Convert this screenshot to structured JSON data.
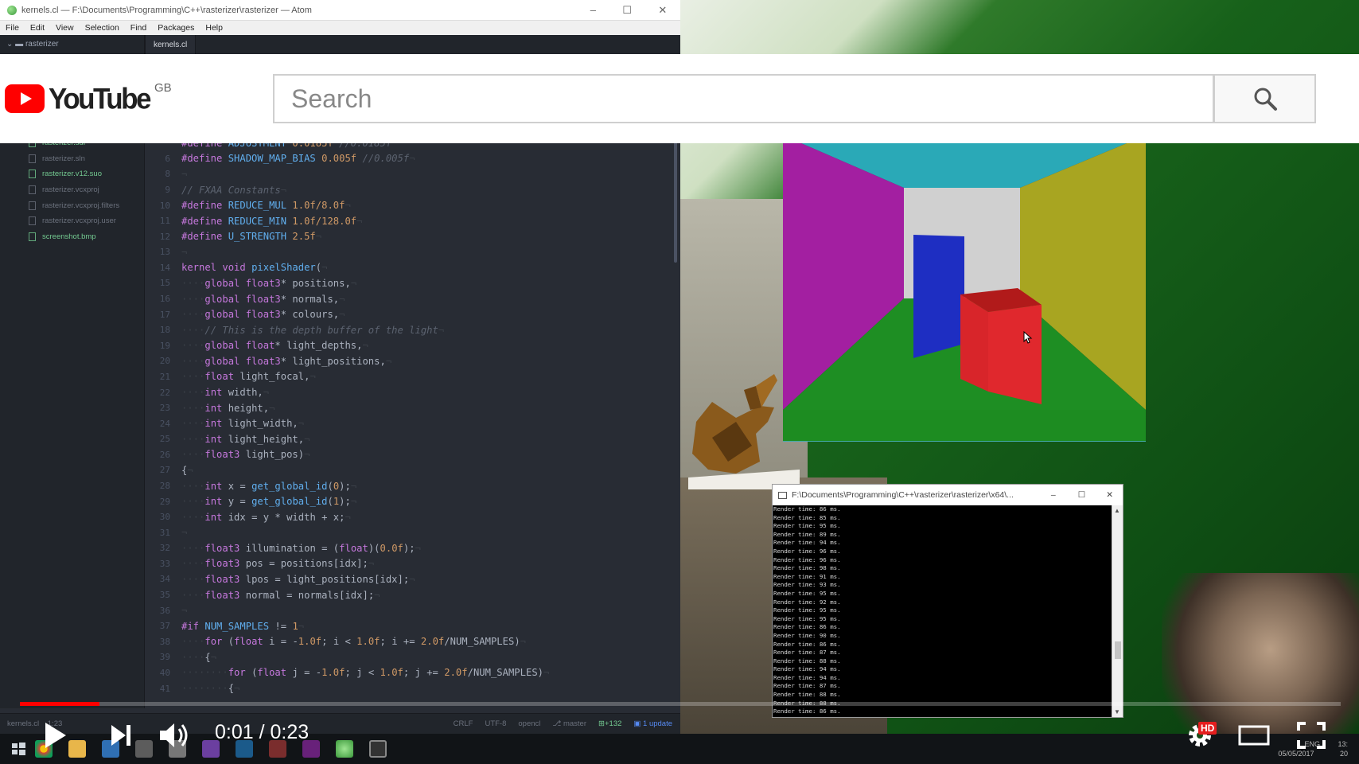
{
  "atom": {
    "title": "kernels.cl — F:\\Documents\\Programming\\C++\\rasterizer\\rasterizer — Atom",
    "menu": [
      "File",
      "Edit",
      "View",
      "Selection",
      "Find",
      "Packages",
      "Help"
    ],
    "tree_root": "rasterizer",
    "active_tab": "kernels.cl",
    "files": [
      {
        "name": "rasterizer.sdf",
        "color": "#73c990"
      },
      {
        "name": "rasterizer.sln",
        "color": "#6b717d"
      },
      {
        "name": "rasterizer.v12.suo",
        "color": "#73c990"
      },
      {
        "name": "rasterizer.vcxproj",
        "color": "#6b717d"
      },
      {
        "name": "rasterizer.vcxproj.filters",
        "color": "#6b717d"
      },
      {
        "name": "rasterizer.vcxproj.user",
        "color": "#6b717d"
      },
      {
        "name": "screenshot.bmp",
        "color": "#73c990"
      }
    ],
    "code_lines": [
      {
        "n": "",
        "segs": [
          {
            "t": "#define ",
            "c": "t-pp"
          },
          {
            "t": "ADJUSTMENT ",
            "c": "t-fn"
          },
          {
            "t": "0.0185f ",
            "c": "t-num"
          },
          {
            "t": "//0.0185f",
            "c": "t-com"
          }
        ]
      },
      {
        "n": "6",
        "segs": [
          {
            "t": "#define ",
            "c": "t-pp"
          },
          {
            "t": "SHADOW_MAP_BIAS ",
            "c": "t-fn"
          },
          {
            "t": "0.005f ",
            "c": "t-num"
          },
          {
            "t": "//0.005f",
            "c": "t-com"
          },
          {
            "t": "¬",
            "c": "t-ws"
          }
        ]
      },
      {
        "n": "8",
        "segs": [
          {
            "t": "¬",
            "c": "t-ws"
          }
        ]
      },
      {
        "n": "9",
        "segs": [
          {
            "t": "// FXAA Constants",
            "c": "t-com"
          },
          {
            "t": "¬",
            "c": "t-ws"
          }
        ]
      },
      {
        "n": "10",
        "segs": [
          {
            "t": "#define ",
            "c": "t-pp"
          },
          {
            "t": "REDUCE_MUL ",
            "c": "t-fn"
          },
          {
            "t": "1.0f/8.0f",
            "c": "t-num"
          },
          {
            "t": "¬",
            "c": "t-ws"
          }
        ]
      },
      {
        "n": "11",
        "segs": [
          {
            "t": "#define ",
            "c": "t-pp"
          },
          {
            "t": "REDUCE_MIN ",
            "c": "t-fn"
          },
          {
            "t": "1.0f/128.0f",
            "c": "t-num"
          },
          {
            "t": "¬",
            "c": "t-ws"
          }
        ]
      },
      {
        "n": "12",
        "segs": [
          {
            "t": "#define ",
            "c": "t-pp"
          },
          {
            "t": "U_STRENGTH ",
            "c": "t-fn"
          },
          {
            "t": "2.5f",
            "c": "t-num"
          },
          {
            "t": "¬",
            "c": "t-ws"
          }
        ]
      },
      {
        "n": "13",
        "segs": [
          {
            "t": "¬",
            "c": "t-ws"
          }
        ]
      },
      {
        "n": "14",
        "segs": [
          {
            "t": "kernel void ",
            "c": "t-kw"
          },
          {
            "t": "pixelShader",
            "c": "t-fn"
          },
          {
            "t": "(",
            "c": "txt"
          },
          {
            "t": "¬",
            "c": "t-ws"
          }
        ]
      },
      {
        "n": "15",
        "segs": [
          {
            "t": "····",
            "c": "t-ws"
          },
          {
            "t": "global float3",
            "c": "t-kw"
          },
          {
            "t": "* positions,",
            "c": "txt"
          },
          {
            "t": "¬",
            "c": "t-ws"
          }
        ]
      },
      {
        "n": "16",
        "segs": [
          {
            "t": "····",
            "c": "t-ws"
          },
          {
            "t": "global float3",
            "c": "t-kw"
          },
          {
            "t": "* normals,",
            "c": "txt"
          },
          {
            "t": "¬",
            "c": "t-ws"
          }
        ]
      },
      {
        "n": "17",
        "segs": [
          {
            "t": "····",
            "c": "t-ws"
          },
          {
            "t": "global float3",
            "c": "t-kw"
          },
          {
            "t": "* colours,",
            "c": "txt"
          },
          {
            "t": "¬",
            "c": "t-ws"
          }
        ]
      },
      {
        "n": "18",
        "segs": [
          {
            "t": "····",
            "c": "t-ws"
          },
          {
            "t": "// This is the depth buffer of the light",
            "c": "t-com"
          },
          {
            "t": "¬",
            "c": "t-ws"
          }
        ]
      },
      {
        "n": "19",
        "segs": [
          {
            "t": "····",
            "c": "t-ws"
          },
          {
            "t": "global float",
            "c": "t-kw"
          },
          {
            "t": "* light_depths,",
            "c": "txt"
          },
          {
            "t": "¬",
            "c": "t-ws"
          }
        ]
      },
      {
        "n": "20",
        "segs": [
          {
            "t": "····",
            "c": "t-ws"
          },
          {
            "t": "global float3",
            "c": "t-kw"
          },
          {
            "t": "* light_positions,",
            "c": "txt"
          },
          {
            "t": "¬",
            "c": "t-ws"
          }
        ]
      },
      {
        "n": "21",
        "segs": [
          {
            "t": "····",
            "c": "t-ws"
          },
          {
            "t": "float ",
            "c": "t-kw"
          },
          {
            "t": "light_focal,",
            "c": "txt"
          },
          {
            "t": "¬",
            "c": "t-ws"
          }
        ]
      },
      {
        "n": "22",
        "segs": [
          {
            "t": "····",
            "c": "t-ws"
          },
          {
            "t": "int ",
            "c": "t-kw"
          },
          {
            "t": "width,",
            "c": "txt"
          },
          {
            "t": "¬",
            "c": "t-ws"
          }
        ]
      },
      {
        "n": "23",
        "segs": [
          {
            "t": "····",
            "c": "t-ws"
          },
          {
            "t": "int ",
            "c": "t-kw"
          },
          {
            "t": "height,",
            "c": "txt"
          },
          {
            "t": "¬",
            "c": "t-ws"
          }
        ]
      },
      {
        "n": "24",
        "segs": [
          {
            "t": "····",
            "c": "t-ws"
          },
          {
            "t": "int ",
            "c": "t-kw"
          },
          {
            "t": "light_width,",
            "c": "txt"
          },
          {
            "t": "¬",
            "c": "t-ws"
          }
        ]
      },
      {
        "n": "25",
        "segs": [
          {
            "t": "····",
            "c": "t-ws"
          },
          {
            "t": "int ",
            "c": "t-kw"
          },
          {
            "t": "light_height,",
            "c": "txt"
          },
          {
            "t": "¬",
            "c": "t-ws"
          }
        ]
      },
      {
        "n": "26",
        "segs": [
          {
            "t": "····",
            "c": "t-ws"
          },
          {
            "t": "float3 ",
            "c": "t-kw"
          },
          {
            "t": "light_pos)",
            "c": "txt"
          },
          {
            "t": "¬",
            "c": "t-ws"
          }
        ]
      },
      {
        "n": "27",
        "segs": [
          {
            "t": "{",
            "c": "txt"
          },
          {
            "t": "¬",
            "c": "t-ws"
          }
        ]
      },
      {
        "n": "28",
        "segs": [
          {
            "t": "····",
            "c": "t-ws"
          },
          {
            "t": "int ",
            "c": "t-kw"
          },
          {
            "t": "x = ",
            "c": "txt"
          },
          {
            "t": "get_global_id",
            "c": "t-fn"
          },
          {
            "t": "(",
            "c": "txt"
          },
          {
            "t": "0",
            "c": "t-num"
          },
          {
            "t": ");",
            "c": "txt"
          },
          {
            "t": "¬",
            "c": "t-ws"
          }
        ]
      },
      {
        "n": "29",
        "segs": [
          {
            "t": "····",
            "c": "t-ws"
          },
          {
            "t": "int ",
            "c": "t-kw"
          },
          {
            "t": "y = ",
            "c": "txt"
          },
          {
            "t": "get_global_id",
            "c": "t-fn"
          },
          {
            "t": "(",
            "c": "txt"
          },
          {
            "t": "1",
            "c": "t-num"
          },
          {
            "t": ");",
            "c": "txt"
          },
          {
            "t": "¬",
            "c": "t-ws"
          }
        ]
      },
      {
        "n": "30",
        "segs": [
          {
            "t": "····",
            "c": "t-ws"
          },
          {
            "t": "int ",
            "c": "t-kw"
          },
          {
            "t": "idx = y * width + x;",
            "c": "txt"
          },
          {
            "t": "¬",
            "c": "t-ws"
          }
        ]
      },
      {
        "n": "31",
        "segs": [
          {
            "t": "¬",
            "c": "t-ws"
          }
        ]
      },
      {
        "n": "32",
        "segs": [
          {
            "t": "····",
            "c": "t-ws"
          },
          {
            "t": "float3 ",
            "c": "t-kw"
          },
          {
            "t": "illumination = (",
            "c": "txt"
          },
          {
            "t": "float",
            "c": "t-kw"
          },
          {
            "t": ")(",
            "c": "txt"
          },
          {
            "t": "0.0f",
            "c": "t-num"
          },
          {
            "t": ");",
            "c": "txt"
          },
          {
            "t": "¬",
            "c": "t-ws"
          }
        ]
      },
      {
        "n": "33",
        "segs": [
          {
            "t": "····",
            "c": "t-ws"
          },
          {
            "t": "float3 ",
            "c": "t-kw"
          },
          {
            "t": "pos = positions[idx];",
            "c": "txt"
          },
          {
            "t": "¬",
            "c": "t-ws"
          }
        ]
      },
      {
        "n": "34",
        "segs": [
          {
            "t": "····",
            "c": "t-ws"
          },
          {
            "t": "float3 ",
            "c": "t-kw"
          },
          {
            "t": "lpos = light_positions[idx];",
            "c": "txt"
          },
          {
            "t": "¬",
            "c": "t-ws"
          }
        ]
      },
      {
        "n": "35",
        "segs": [
          {
            "t": "····",
            "c": "t-ws"
          },
          {
            "t": "float3 ",
            "c": "t-kw"
          },
          {
            "t": "normal = normals[idx];",
            "c": "txt"
          },
          {
            "t": "¬",
            "c": "t-ws"
          }
        ]
      },
      {
        "n": "36",
        "segs": [
          {
            "t": "¬",
            "c": "t-ws"
          }
        ]
      },
      {
        "n": "37",
        "segs": [
          {
            "t": "#if ",
            "c": "t-pp"
          },
          {
            "t": "NUM_SAMPLES ",
            "c": "t-fn"
          },
          {
            "t": "!= ",
            "c": "txt"
          },
          {
            "t": "1",
            "c": "t-num"
          },
          {
            "t": "¬",
            "c": "t-ws"
          }
        ]
      },
      {
        "n": "38",
        "segs": [
          {
            "t": "····",
            "c": "t-ws"
          },
          {
            "t": "for ",
            "c": "t-kw"
          },
          {
            "t": "(",
            "c": "txt"
          },
          {
            "t": "float ",
            "c": "t-kw"
          },
          {
            "t": "i = -",
            "c": "txt"
          },
          {
            "t": "1.0f",
            "c": "t-num"
          },
          {
            "t": "; i < ",
            "c": "txt"
          },
          {
            "t": "1.0f",
            "c": "t-num"
          },
          {
            "t": "; i += ",
            "c": "txt"
          },
          {
            "t": "2.0f",
            "c": "t-num"
          },
          {
            "t": "/NUM_SAMPLES)",
            "c": "txt"
          },
          {
            "t": "¬",
            "c": "t-ws"
          }
        ]
      },
      {
        "n": "39",
        "segs": [
          {
            "t": "····",
            "c": "t-ws"
          },
          {
            "t": "{",
            "c": "txt"
          },
          {
            "t": "¬",
            "c": "t-ws"
          }
        ]
      },
      {
        "n": "40",
        "segs": [
          {
            "t": "········",
            "c": "t-ws"
          },
          {
            "t": "for ",
            "c": "t-kw"
          },
          {
            "t": "(",
            "c": "txt"
          },
          {
            "t": "float ",
            "c": "t-kw"
          },
          {
            "t": "j = -",
            "c": "txt"
          },
          {
            "t": "1.0f",
            "c": "t-num"
          },
          {
            "t": "; j < ",
            "c": "txt"
          },
          {
            "t": "1.0f",
            "c": "t-num"
          },
          {
            "t": "; j += ",
            "c": "txt"
          },
          {
            "t": "2.0f",
            "c": "t-num"
          },
          {
            "t": "/NUM_SAMPLES)",
            "c": "txt"
          },
          {
            "t": "¬",
            "c": "t-ws"
          }
        ]
      },
      {
        "n": "41",
        "segs": [
          {
            "t": "········",
            "c": "t-ws"
          },
          {
            "t": "{",
            "c": "txt"
          },
          {
            "t": "¬",
            "c": "t-ws"
          }
        ]
      }
    ],
    "status": {
      "file": "kernels.cl",
      "position": "1:23",
      "line_ending": "CRLF",
      "encoding": "UTF-8",
      "grammar": "opencl",
      "branch": "master",
      "diff": "+132",
      "updates": "1 update"
    }
  },
  "console": {
    "title": "F:\\Documents\\Programming\\C++\\rasterizer\\rasterizer\\x64\\...",
    "lines": [
      "Render time: 86 ms.",
      "Render time: 85 ms.",
      "Render time: 95 ms.",
      "Render time: 89 ms.",
      "Render time: 94 ms.",
      "Render time: 96 ms.",
      "Render time: 96 ms.",
      "Render time: 98 ms.",
      "Render time: 91 ms.",
      "Render time: 93 ms.",
      "Render time: 95 ms.",
      "Render time: 92 ms.",
      "Render time: 95 ms.",
      "Render time: 95 ms.",
      "Render time: 86 ms.",
      "Render time: 90 ms.",
      "Render time: 86 ms.",
      "Render time: 87 ms.",
      "Render time: 88 ms.",
      "Render time: 94 ms.",
      "Render time: 94 ms.",
      "Render time: 87 ms.",
      "Render time: 88 ms.",
      "Render time: 88 ms.",
      "Render time: 86 ms."
    ]
  },
  "youtube": {
    "logo_text": "YouTube",
    "region": "GB",
    "search_placeholder": "Search"
  },
  "player": {
    "time": "0:01 / 0:23",
    "progress": 0.06,
    "hd_label": "HD"
  },
  "taskbar": {
    "clock": "13:",
    "date": "05/05/2017",
    "lang": "ENG",
    "notifications": "20"
  }
}
